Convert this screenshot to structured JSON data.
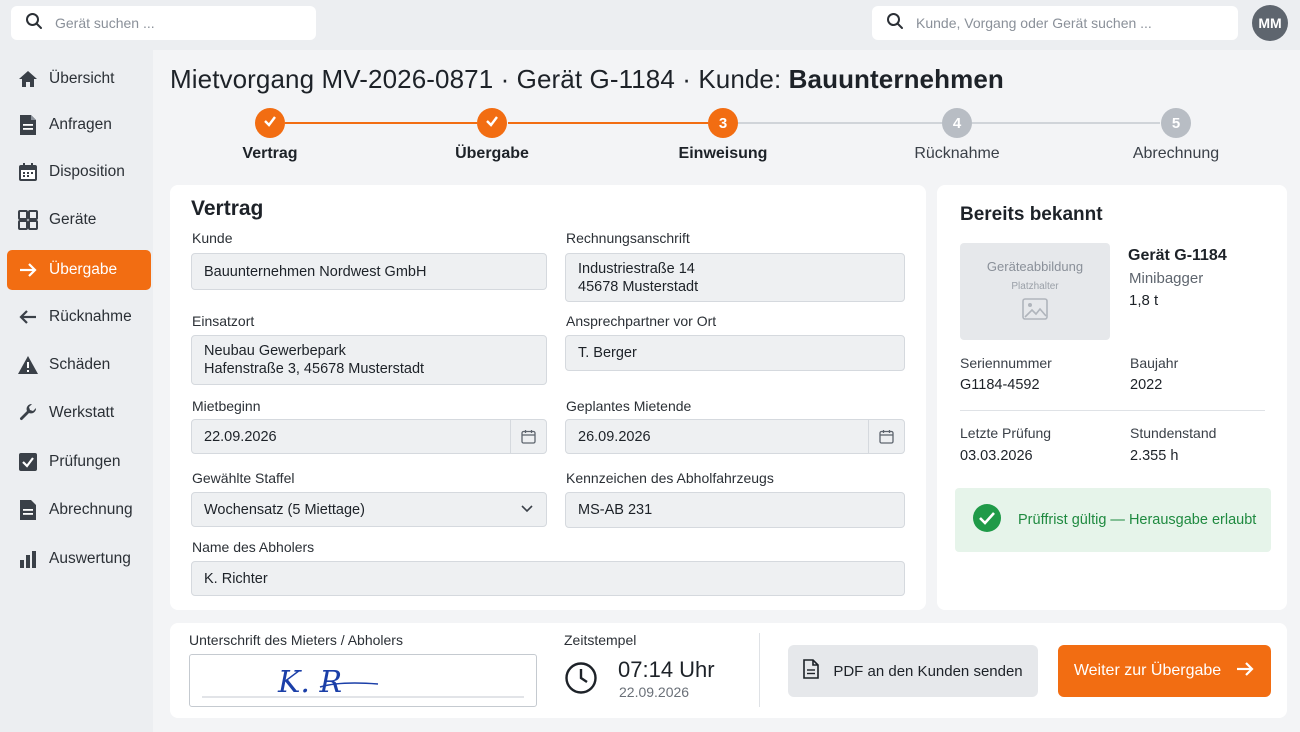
{
  "header": {
    "device_search_placeholder": "Gerät suchen ...",
    "global_search_placeholder": "Kunde, Vorgang oder Gerät suchen ...",
    "user_initials": "MM"
  },
  "sidebar": {
    "items": [
      {
        "label": "Übersicht",
        "icon": "home-icon"
      },
      {
        "label": "Anfragen",
        "icon": "document-icon"
      },
      {
        "label": "Disposition",
        "icon": "calendar-icon"
      },
      {
        "label": "Geräte",
        "icon": "grid-icon"
      },
      {
        "label": "Übergabe",
        "icon": "arrow-right-icon",
        "active": true
      },
      {
        "label": "Rücknahme",
        "icon": "arrow-left-icon"
      },
      {
        "label": "Schäden",
        "icon": "warning-icon"
      },
      {
        "label": "Werkstatt",
        "icon": "wrench-icon"
      },
      {
        "label": "Prüfungen",
        "icon": "checkbox-icon"
      },
      {
        "label": "Abrechnung",
        "icon": "invoice-icon"
      },
      {
        "label": "Auswertung",
        "icon": "bar-chart-icon"
      }
    ]
  },
  "title": {
    "prefix": "Mietvorgang MV-2026-0871 · Gerät G-1184 · Kunde: ",
    "customer": "Bauunternehmen"
  },
  "stepper": {
    "steps": [
      {
        "label": "Vertrag",
        "state": "done"
      },
      {
        "label": "Übergabe",
        "state": "done"
      },
      {
        "number": "3",
        "label": "Einweisung",
        "state": "current"
      },
      {
        "number": "4",
        "label": "Rücknahme",
        "state": "pending"
      },
      {
        "number": "5",
        "label": "Abrechnung",
        "state": "pending"
      }
    ]
  },
  "contract": {
    "title": "Vertrag",
    "customer_label": "Kunde",
    "customer_value": "Bauunternehmen Nordwest GmbH",
    "billing_label": "Rechnungsanschrift",
    "billing_line1": "Industriestraße 14",
    "billing_line2": "45678 Musterstadt",
    "site_label": "Einsatzort",
    "site_line1": "Neubau Gewerbepark",
    "site_line2": "Hafenstraße 3, 45678 Musterstadt",
    "contact_label": "Ansprechpartner vor Ort",
    "contact_value": "T. Berger",
    "start_label": "Mietbeginn",
    "start_value": "22.09.2026",
    "end_label": "Geplantes Mietende",
    "end_value": "26.09.2026",
    "rate_label": "Gewählte Staffel",
    "rate_value": "Wochensatz (5 Miettage)",
    "plate_label": "Kennzeichen des Abholfahrzeugs",
    "plate_value": "MS-AB 231",
    "pickup_label": "Name des Abholers",
    "pickup_value": "K. Richter"
  },
  "known": {
    "title": "Bereits bekannt",
    "image_placeholder_title": "Geräteabbildung",
    "image_placeholder_sub": "Platzhalter",
    "device_name": "Gerät G-1184",
    "device_type": "Minibagger",
    "device_weight": "1,8 t",
    "serial_label": "Seriennummer",
    "serial_value": "G1184-4592",
    "year_label": "Baujahr",
    "year_value": "2022",
    "inspection_label": "Letzte Prüfung",
    "inspection_value": "03.03.2026",
    "hours_label": "Stundenstand",
    "hours_value": "2.355 h",
    "status_text": "Prüffrist gültig — Herausgabe erlaubt"
  },
  "footer": {
    "signature_label": "Unterschrift des Mieters / Abholers",
    "signature_text": "K. R",
    "timestamp_label": "Zeitstempel",
    "time": "07:14 Uhr",
    "date": "22.09.2026",
    "pdf_button": "PDF an den Kunden senden",
    "next_button": "Weiter zur Übergabe"
  },
  "colors": {
    "accent": "#f26d12",
    "success": "#1f9a48",
    "success_bg": "#e6f4ea",
    "pending": "#b8bdc4"
  }
}
